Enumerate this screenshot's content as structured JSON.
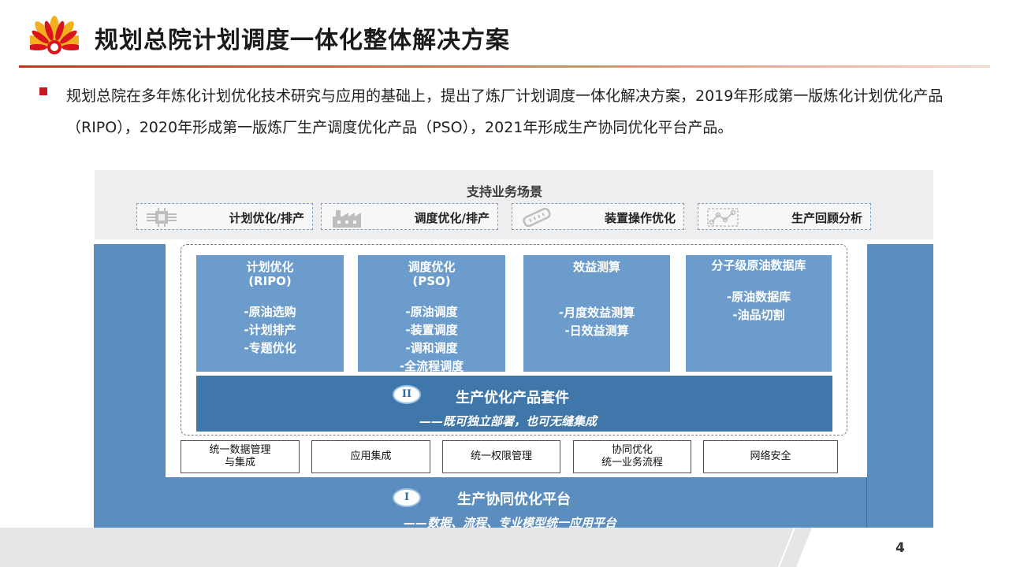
{
  "header": {
    "title": "规划总院计划调度一体化整体解决方案"
  },
  "intro": {
    "text": "规划总院在多年炼化计划优化技术研究与应用的基础上，提出了炼厂计划调度一体化解决方案，2019年形成第一版炼化计划优化产品（RIPO），2020年形成第一版炼厂生产调度优化产品（PSO），2021年形成生产协同优化平台产品。"
  },
  "scenarios": {
    "title": "支持业务场景",
    "items": [
      {
        "label": "计划优化/排产",
        "icon": "chip-icon"
      },
      {
        "label": "调度优化/排产",
        "icon": "factory-icon"
      },
      {
        "label": "装置操作优化",
        "icon": "device-icon"
      },
      {
        "label": "生产回顾分析",
        "icon": "chart-icon"
      }
    ]
  },
  "cards": [
    {
      "title1": "计划优化",
      "title2": "(RIPO)",
      "items": [
        "-原油选购",
        "-计划排产",
        "-专题优化"
      ]
    },
    {
      "title1": "调度优化",
      "title2": "(PSO)",
      "items": [
        "-原油调度",
        "-装置调度",
        "-调和调度",
        "-全流程调度"
      ]
    },
    {
      "title1": "效益测算",
      "title2": "",
      "items": [
        "-月度效益测算",
        "-日效益测算"
      ]
    },
    {
      "title1": "分子级原油数据库",
      "title2": "",
      "items": [
        "-原油数据库",
        "-油品切割"
      ]
    }
  ],
  "suite": {
    "badge": "II",
    "title": "生产优化产品套件",
    "subtitle": "——既可独立部署，也可无缝集成"
  },
  "modules": [
    {
      "line1": "统一数据管理",
      "line2": "与集成"
    },
    {
      "line1": "应用集成",
      "line2": ""
    },
    {
      "line1": "统一权限管理",
      "line2": ""
    },
    {
      "line1": "协同优化",
      "line2": "统一业务流程"
    },
    {
      "line1": "网络安全",
      "line2": ""
    }
  ],
  "platform": {
    "badge": "I",
    "title": "生产协同优化平台",
    "subtitle": "——数据、流程、专业模型统一应用平台"
  },
  "footer": {
    "page_number": "4"
  },
  "colors": {
    "brand_red": "#c8161e",
    "brand_yellow": "#f2b01e",
    "platform_blue": "#5b8dbf",
    "card_blue": "#6b9ccb",
    "suite_blue": "#3f77aa"
  }
}
